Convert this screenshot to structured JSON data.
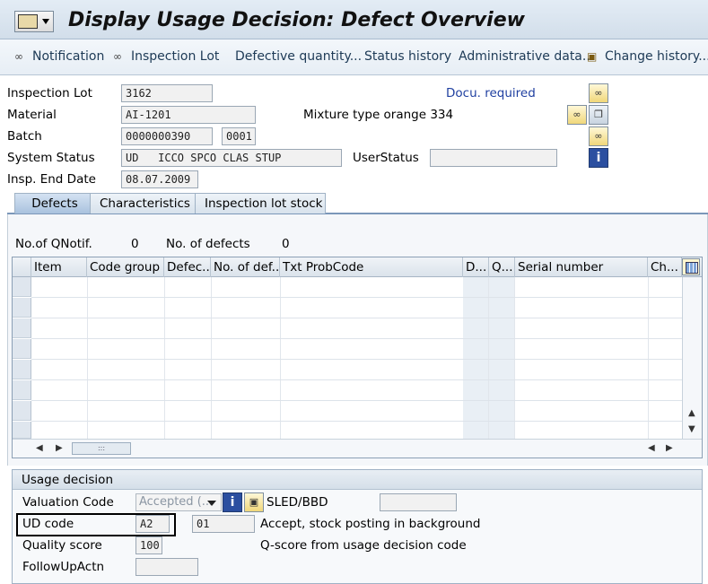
{
  "window": {
    "title": "Display Usage Decision: Defect Overview"
  },
  "toolbar": {
    "notification": "Notification",
    "inspection_lot": "Inspection Lot",
    "defective_quantity": "Defective quantity...",
    "status_history": "Status history",
    "administrative_data": "Administrative data...",
    "change_history": "Change history..."
  },
  "header": {
    "inspection_lot_label": "Inspection Lot",
    "inspection_lot_value": "3162",
    "docu_required": "Docu. required",
    "material_label": "Material",
    "material_value": "AI-1201",
    "material_desc": "Mixture type orange 334",
    "batch_label": "Batch",
    "batch_value": "0000000390",
    "batch_sub_value": "0001",
    "system_status_label": "System Status",
    "system_status_value": "UD   ICCO SPCO CLAS STUP",
    "user_status_label": "UserStatus",
    "user_status_value": "",
    "insp_end_date_label": "Insp. End Date",
    "insp_end_date_value": "08.07.2009"
  },
  "tabs": [
    {
      "label": "Defects",
      "active": true
    },
    {
      "label": "Characteristics",
      "active": false
    },
    {
      "label": "Inspection lot stock",
      "active": false
    }
  ],
  "defects": {
    "qnotif_label": "No.of QNotif.",
    "qnotif_value": "0",
    "defects_label": "No. of defects",
    "defects_value": "0",
    "columns": [
      "Item",
      "Code group",
      "Defec...",
      "No. of def...",
      "Txt ProbCode",
      "D...",
      "Q...",
      "Serial number",
      "Ch..."
    ]
  },
  "usage_decision": {
    "title": "Usage decision",
    "valuation_code_label": "Valuation Code",
    "valuation_code_value": "Accepted (...",
    "sled_bbd_label": "SLED/BBD",
    "sled_bbd_value": "",
    "ud_code_label": "UD code",
    "ud_code_value": "A2",
    "ud_code_sub_value": "01",
    "ud_code_desc": "Accept, stock posting in background",
    "quality_score_label": "Quality score",
    "quality_score_value": "100",
    "quality_score_desc": "Q-score from usage decision code",
    "followup_label": "FollowUpActn",
    "followup_value": ""
  }
}
